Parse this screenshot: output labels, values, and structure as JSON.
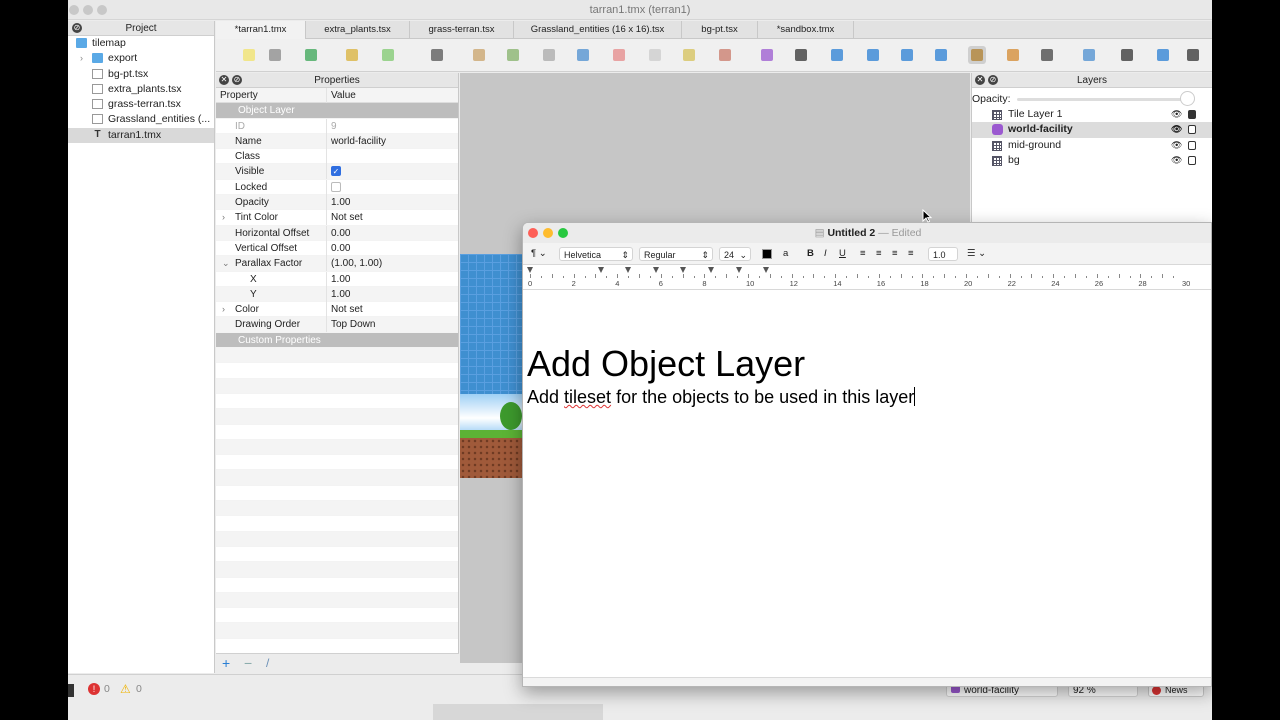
{
  "window": {
    "title": "tarran1.tmx (terran1)"
  },
  "project": {
    "title": "Project",
    "items": [
      {
        "label": "tilemap",
        "kind": "folder",
        "depth": 0
      },
      {
        "label": "export",
        "kind": "folder",
        "depth": 1
      },
      {
        "label": "bg-pt.tsx",
        "kind": "file",
        "depth": 1
      },
      {
        "label": "extra_plants.tsx",
        "kind": "file",
        "depth": 1
      },
      {
        "label": "grass-terran.tsx",
        "kind": "file",
        "depth": 1
      },
      {
        "label": "Grassland_entities (...",
        "kind": "file",
        "depth": 1
      },
      {
        "label": "tarran1.tmx",
        "kind": "tmx",
        "depth": 1,
        "selected": true
      }
    ]
  },
  "tabs": [
    {
      "label": "*tarran1.tmx",
      "active": true
    },
    {
      "label": "extra_plants.tsx"
    },
    {
      "label": "grass-terran.tsx"
    },
    {
      "label": "Grassland_entities (16 x 16).tsx"
    },
    {
      "label": "bg-pt.tsx"
    },
    {
      "label": "*sandbox.tmx"
    }
  ],
  "properties": {
    "title": "Properties",
    "col_property": "Property",
    "col_value": "Value",
    "section_object_layer": "Object Layer",
    "section_custom": "Custom Properties",
    "rows": [
      {
        "key": "ID",
        "value": "9",
        "dim": true
      },
      {
        "key": "Name",
        "value": "world-facility"
      },
      {
        "key": "Class",
        "value": ""
      },
      {
        "key": "Visible",
        "value": "",
        "checkbox": true,
        "checked": true
      },
      {
        "key": "Locked",
        "value": "",
        "checkbox": true,
        "checked": false
      },
      {
        "key": "Opacity",
        "value": "1.00"
      },
      {
        "key": "Tint Color",
        "value": "Not set",
        "expand": "collapsed"
      },
      {
        "key": "Horizontal Offset",
        "value": "0.00"
      },
      {
        "key": "Vertical Offset",
        "value": "0.00"
      },
      {
        "key": "Parallax Factor",
        "value": "(1.00, 1.00)",
        "expand": "expanded"
      },
      {
        "key": "X",
        "value": "1.00",
        "indent": true
      },
      {
        "key": "Y",
        "value": "1.00",
        "indent": true
      },
      {
        "key": "Color",
        "value": "Not set",
        "expand": "collapsed"
      },
      {
        "key": "Drawing Order",
        "value": "Top Down"
      }
    ]
  },
  "layers": {
    "title": "Layers",
    "opacity_label": "Opacity:",
    "opacity_level": 1.0,
    "items": [
      {
        "label": "Tile Layer 1",
        "kind": "tile",
        "locked": true
      },
      {
        "label": "world-facility",
        "kind": "object",
        "selected": true,
        "locked": false
      },
      {
        "label": "mid-ground",
        "kind": "tile",
        "locked": false
      },
      {
        "label": "bg",
        "kind": "tile",
        "locked": false
      }
    ]
  },
  "status": {
    "errors": "0",
    "warnings": "0",
    "layer_select": "world-facility",
    "zoom": "92 %",
    "news": "News"
  },
  "textedit": {
    "title": "Untitled 2",
    "edited": "— Edited",
    "font": "Helvetica",
    "style": "Regular",
    "size": "24",
    "spacing": "1.0",
    "ruler_numbers": [
      "0",
      "2",
      "4",
      "6",
      "8",
      "10",
      "12",
      "14",
      "16",
      "18",
      "20",
      "22",
      "24",
      "26",
      "28",
      "30"
    ],
    "heading": "Add Object Layer",
    "body_pre": "Add ",
    "body_misspelled": "tileset",
    "body_post": " for the objects to be used in this layer"
  },
  "colors": {
    "accent": "#2f6ee0",
    "selected_row": "#dcdcdc",
    "section_header": "#bdbdbd",
    "object_layer_icon": "#9b59d0"
  }
}
